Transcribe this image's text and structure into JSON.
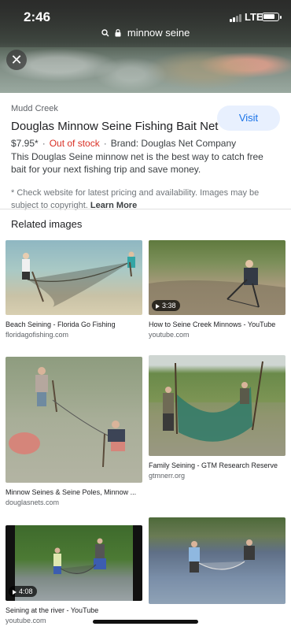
{
  "status_bar": {
    "time": "2:46",
    "network": "LTE",
    "battery_percent": 80
  },
  "url_bar": {
    "text": "minnow seine",
    "search_icon": "search-icon",
    "lock_icon": "lock-icon"
  },
  "close_icon": "close-icon",
  "result": {
    "source": "Mudd Creek",
    "title": "Douglas Minnow Seine Fishing Bait Net",
    "visit_label": "Visit",
    "price": "$7.95*",
    "stock": "Out of stock",
    "brand": "Brand: Douglas Net Company",
    "description": "This Douglas Seine minnow net is the best way to catch free bait for your next fishing trip and save money.",
    "note": "* Check website for latest pricing and availability. Images may be subject to copyright.",
    "learn_more": "Learn More"
  },
  "related": {
    "heading": "Related images",
    "items": [
      {
        "caption": "Beach Seining - Florida Go Fishing",
        "domain": "floridagofishing.com",
        "duration": ""
      },
      {
        "caption": "How to Seine Creek Minnows - YouTube",
        "domain": "youtube.com",
        "duration": "3:38"
      },
      {
        "caption": "Minnow Seines & Seine Poles, Minnow ...",
        "domain": "douglasnets.com",
        "duration": ""
      },
      {
        "caption": "Family Seining - GTM Research Reserve",
        "domain": "gtmnerr.org",
        "duration": ""
      },
      {
        "caption": "Seining at the river - YouTube",
        "domain": "youtube.com",
        "duration": "4:08"
      },
      {
        "caption": "",
        "domain": "",
        "duration": ""
      }
    ]
  },
  "colors": {
    "accent": "#1a73e8",
    "out_of_stock": "#d93025",
    "visit_bg": "#e8f0fe"
  }
}
